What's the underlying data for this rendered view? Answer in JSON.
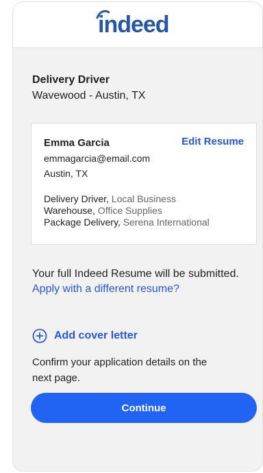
{
  "brand": {
    "logo_text": "indeed",
    "color": "#2557a7"
  },
  "job": {
    "title": "Delivery Driver",
    "location": "Wavewood - Austin, TX"
  },
  "resume": {
    "name": "Emma Garcia",
    "edit_label": "Edit Resume",
    "email": "emmagarcia@email.com",
    "city": "Austin, TX",
    "experience": [
      {
        "role": "Delivery Driver",
        "org": "Local Business"
      },
      {
        "role": "Warehouse",
        "org": "Office Supplies"
      },
      {
        "role": "Package Delivery",
        "org": "Serena International"
      }
    ]
  },
  "submit_note": "Your full Indeed Resume will be submitted.",
  "different_resume_link": "Apply with a different resume?",
  "cover_letter": {
    "label": "Add cover letter",
    "icon": "plus-circle-icon"
  },
  "confirm_text": "Confirm your application details on the next page.",
  "continue_label": "Continue",
  "colors": {
    "accent": "#2164f3",
    "link": "#2557d6",
    "panel": "#f2f2f2"
  }
}
